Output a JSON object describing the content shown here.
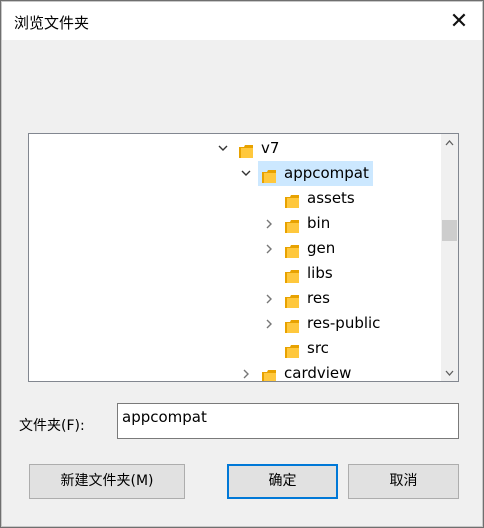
{
  "dialog": {
    "title": "浏览文件夹",
    "close_glyph": "✕"
  },
  "tree": {
    "items": [
      {
        "label": "v7",
        "expanded": true,
        "selected": false
      },
      {
        "label": "appcompat",
        "expanded": true,
        "selected": true
      },
      {
        "label": "assets",
        "expanded": null,
        "selected": false
      },
      {
        "label": "bin",
        "expanded": false,
        "selected": false
      },
      {
        "label": "gen",
        "expanded": false,
        "selected": false
      },
      {
        "label": "libs",
        "expanded": null,
        "selected": false
      },
      {
        "label": "res",
        "expanded": false,
        "selected": false
      },
      {
        "label": "res-public",
        "expanded": false,
        "selected": false
      },
      {
        "label": "src",
        "expanded": null,
        "selected": false
      },
      {
        "label": "cardview",
        "expanded": false,
        "selected": false
      }
    ]
  },
  "folder_field": {
    "label": "文件夹(F):",
    "value": "appcompat"
  },
  "buttons": {
    "new_folder": "新建文件夹(M)",
    "ok": "确定",
    "cancel": "取消"
  },
  "colors": {
    "selection": "#cce8ff",
    "folder": "#ffc83d",
    "accent": "#0078d7"
  }
}
